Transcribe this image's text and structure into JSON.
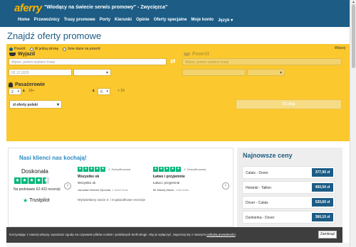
{
  "header": {
    "logo": "aferry",
    "tagline": "\"Wiodący na świecie serwis promowy\" - Zwycięzca\"",
    "nav": [
      "Home",
      "Przewoźnicy",
      "Trasy promowe",
      "Porty",
      "Kierunki",
      "Opinie",
      "Oferty specjalne",
      "Moje konto",
      "Język ▾"
    ]
  },
  "page_title": "Znajdź oferty promowe",
  "search": {
    "trip_types": [
      "Powrót",
      "W jedną stronę",
      "Inne dane na powrót"
    ],
    "more_link": "Więcej",
    "outbound_label": "Wyjazd",
    "return_label": "Powrót",
    "outbound_placeholder": "Wpisz, potem wybierz trasę",
    "return_placeholder": "Wpisz, potem wybierz trasę",
    "date_value": "02.12.2025",
    "passengers_label": "Pasażerowie",
    "adults_value": "2",
    "adults_hint": "16+",
    "children_value": "0",
    "children_hint": "< 16",
    "country_value": "zł oferty polski",
    "search_button": "Szukaj"
  },
  "reviews": {
    "title": "Nasi klienci nas kochają!",
    "rating_label": "Doskonała",
    "count_text": "Na podstawie 62.432 recenzji",
    "trustpilot": "Trustpilot",
    "verified_label": "Zweryfikowana",
    "items": [
      {
        "title": "Wszystko ok",
        "body": "Wszystko ok",
        "author": "Jarosław Norbert Sporzak,",
        "time": "1 dzień temu"
      },
      {
        "title": "Łatwo i przyjemnie",
        "body": "Łatwo i przyjemnie",
        "author": "Mr Maciej Mazur,",
        "time": "3 dni temu"
      }
    ],
    "showing_text": "Wyświetlamy nasze 4- i 5-gwiazdkowe recenzje"
  },
  "prices": {
    "title": "Najnowsze ceny",
    "rows": [
      {
        "route": "Calais - Dover",
        "price": "377,90 zł"
      },
      {
        "route": "Helsinki - Tallinn",
        "price": "450,50 zł"
      },
      {
        "route": "Dover - Calais",
        "price": "520,60 zł"
      },
      {
        "route": "Dunkierka - Dover",
        "price": "360,10 zł"
      }
    ]
  },
  "cookie": {
    "text": "Korzystając z naszej witryny, wyrażasz zgodę na używanie plików cookie i podobnych technologii. Aby je wyłączyć, zapoznaj się z naszymi ",
    "link": "polityką prywatności",
    "button": "Zamknąć"
  },
  "colors": {
    "header_bg": "#1c5c85",
    "search_bg": "#fbc82d",
    "trustpilot_green": "#00b67a",
    "accent_blue": "#2b8bc4"
  }
}
